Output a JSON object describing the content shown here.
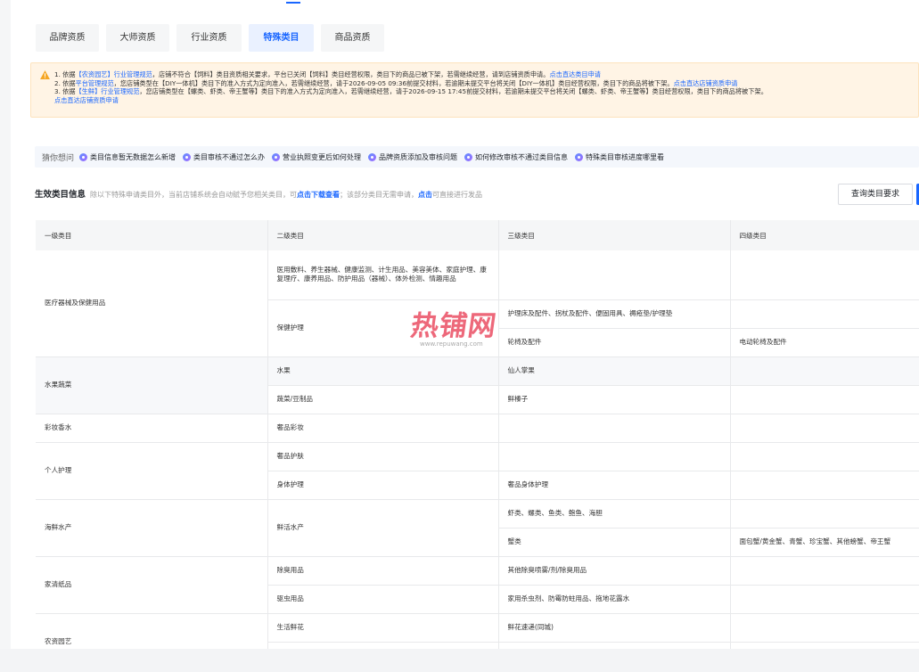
{
  "tabs": [
    {
      "label": "品牌资质",
      "active": false
    },
    {
      "label": "大师资质",
      "active": false
    },
    {
      "label": "行业资质",
      "active": false
    },
    {
      "label": "特殊类目",
      "active": true
    },
    {
      "label": "商品资质",
      "active": false
    }
  ],
  "notice": {
    "line1": {
      "a": "1. 依据",
      "b": "【农资园艺】行业管理规范",
      "c": "，店铺不符合【饲料】类目资质相关要求，平台已关闭【饲料】类目经营权限，类目下的商品已被下架，若需继续经营，请到店铺资质申请。",
      "d": "点击直达类目申请"
    },
    "line2": {
      "a": "2. 依据",
      "b": "平台管理规范",
      "c": "，您店铺类型在【DIY一体机】类目下的准入方式为定向准入，若需继续经营，请于2026-09-05 09:36前提交材料，若逾期未提交平台将关闭【DIY一体机】类目经营权限，类目下的商品将被下架。",
      "d": "点击直达店铺资质申请"
    },
    "line3": {
      "a": "3. 依据",
      "b": "【生鲜】行业管理规范",
      "c": "，您店铺类型在【螺类、虾类、帝王蟹等】类目下的准入方式为定向准入，若需继续经营，请于2026-09-15 17:45前提交材料，若逾期未提交平台将关闭【螺类、虾类、帝王蟹等】类目经营权限，类目下的商品将被下架。"
    },
    "line4": "点击直达店铺资质申请"
  },
  "guess": {
    "title": "猜你想问",
    "items": [
      "类目信息暂无数据怎么新增",
      "类目审核不通过怎么办",
      "营业执照变更后如何处理",
      "品牌资质添加及审核问题",
      "如何修改审核不通过类目信息",
      "特殊类目审核进度哪里看"
    ]
  },
  "section": {
    "title": "生效类目信息",
    "desc1": "除以下特殊申请类目外，当前店铺系统会自动赋予您相关类目，可",
    "link1": "点击下载查看",
    "desc2": "；该部分类目无需申请，",
    "link2": "点击",
    "desc3": "可直接进行发品"
  },
  "query_button": "查询类目要求",
  "table": {
    "headers": [
      "一级类目",
      "二级类目",
      "三级类目",
      "四级类目"
    ],
    "cells": {
      "med": "医疗器械及保健用品",
      "med_l2a": "医用敷料、养生器械、健康监测、计生用品、美容美体、家庭护理、康复理疗、康养用品、防护用品（器械）、体外检测、情趣用品",
      "med_l2b": "保健护理",
      "med_l3a": "护理床及配件、拐杖及配件、便固用具、褥疮垫/护理垫",
      "med_l3b": "轮椅及配件",
      "med_l4b": "电动轮椅及配件",
      "fruit": "水果蔬菜",
      "fruit_l2a": "水果",
      "fruit_l3a": "仙人掌果",
      "fruit_l2b": "蔬菜/豆制品",
      "fruit_l3b": "鲜榛子",
      "makeup": "彩妆香水",
      "makeup_l2": "奢品彩妆",
      "care": "个人护理",
      "care_l2a": "奢品护肤",
      "care_l2b": "身体护理",
      "care_l3b": "奢品身体护理",
      "sea": "海鲜水产",
      "sea_l2": "鲜活水产",
      "sea_l3a": "虾类、螺类、鱼类、鲍鱼、海胆",
      "sea_l3b": "蟹类",
      "sea_l4b": "面包蟹/黄金蟹、青蟹、珍宝蟹、其他螃蟹、帝王蟹",
      "home": "家清纸品",
      "home_l2a": "除臭用品",
      "home_l3a": "其他除臭喷雾/剂/除臭用品",
      "home_l2b": "驱虫用品",
      "home_l3b": "家用杀虫剂、防霉防蛀用品、拖地花露水",
      "garden": "农资园艺",
      "garden_l2a": "生活鲜花",
      "garden_l3a": "鲜花速递(同城)"
    }
  },
  "watermark": {
    "text": "热铺网",
    "url": "www.repuwang.com"
  },
  "colors": {
    "accent": "#1966ff",
    "warning_bg": "#fff4e5",
    "warning_icon": "#f5a623",
    "watermark": "#ea4e63"
  }
}
